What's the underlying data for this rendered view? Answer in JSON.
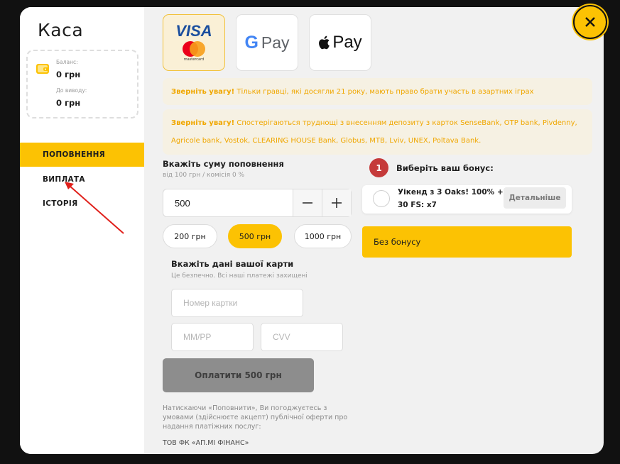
{
  "sidebar": {
    "title": "Каса",
    "balance": {
      "label": "Баланс:",
      "value": "0 грн"
    },
    "withdrawable": {
      "label": "До виводу:",
      "value": "0 грн"
    },
    "items": [
      {
        "label": "ПОПОВНЕННЯ",
        "active": true
      },
      {
        "label": "ВИПЛАТА",
        "active": false
      },
      {
        "label": "ІСТОРІЯ",
        "active": false
      }
    ]
  },
  "payment_methods": [
    {
      "name": "Visa / Mastercard",
      "visa_text": "VISA",
      "mc_text": "mastercard",
      "selected": true
    },
    {
      "name": "Google Pay",
      "text": "Pay"
    },
    {
      "name": "Apple Pay",
      "text": "Pay"
    }
  ],
  "notices": [
    {
      "bold": "Зверніть увагу!",
      "text": " Тільки гравці, які досягли 21 року, мають право брати участь в азартних іграх"
    },
    {
      "bold": "Зверніть увагу!",
      "text_line1": " Спостерігаються труднощі з внесенням депозиту з карток SenseBank, OTP bank, Pivdenny,",
      "text_line2": "Agricole bank, Vostok, CLEARING HOUSE Bank, Globus, MTB, Lviv, UNEX, Poltava Bank."
    }
  ],
  "deposit": {
    "title": "Вкажіть суму поповнення",
    "subtitle": "від 100 грн / комісія 0 %",
    "amount": "500",
    "presets": [
      {
        "label": "200 грн",
        "active": false
      },
      {
        "label": "500 грн",
        "active": true
      },
      {
        "label": "1000 грн",
        "active": false
      }
    ]
  },
  "card": {
    "title": "Вкажіть дані вашої карти",
    "subtitle": "Це безпечно. Всі наші платежі захищені",
    "number_placeholder": "Номер картки",
    "expiry_placeholder": "ММ/РР",
    "cvv_placeholder": "CVV"
  },
  "pay_button": "Оплатити 500 грн",
  "terms": "Натискаючи «Поповнити», Ви погоджуєтесь з умовами (здійснюєте акцепт) публічної оферти про надання платіжних послуг:",
  "company": "ТОВ ФК «АП.МІ ФІНАНС»",
  "bonus": {
    "step": "1",
    "title": "Виберіть ваш бонус:",
    "option_text": "Уікенд з 3 Oaks! 100% + 30 FS: x7",
    "details_label": "Детальніше",
    "no_bonus_label": "Без бонусу"
  },
  "colors": {
    "accent": "#fcc203",
    "badge": "#c53a3a",
    "notice_text": "#f0a700"
  },
  "icons": {
    "close": "close-icon",
    "wallet": "wallet-icon",
    "minus": "minus-icon",
    "plus": "plus-icon",
    "apple": "apple-icon"
  }
}
